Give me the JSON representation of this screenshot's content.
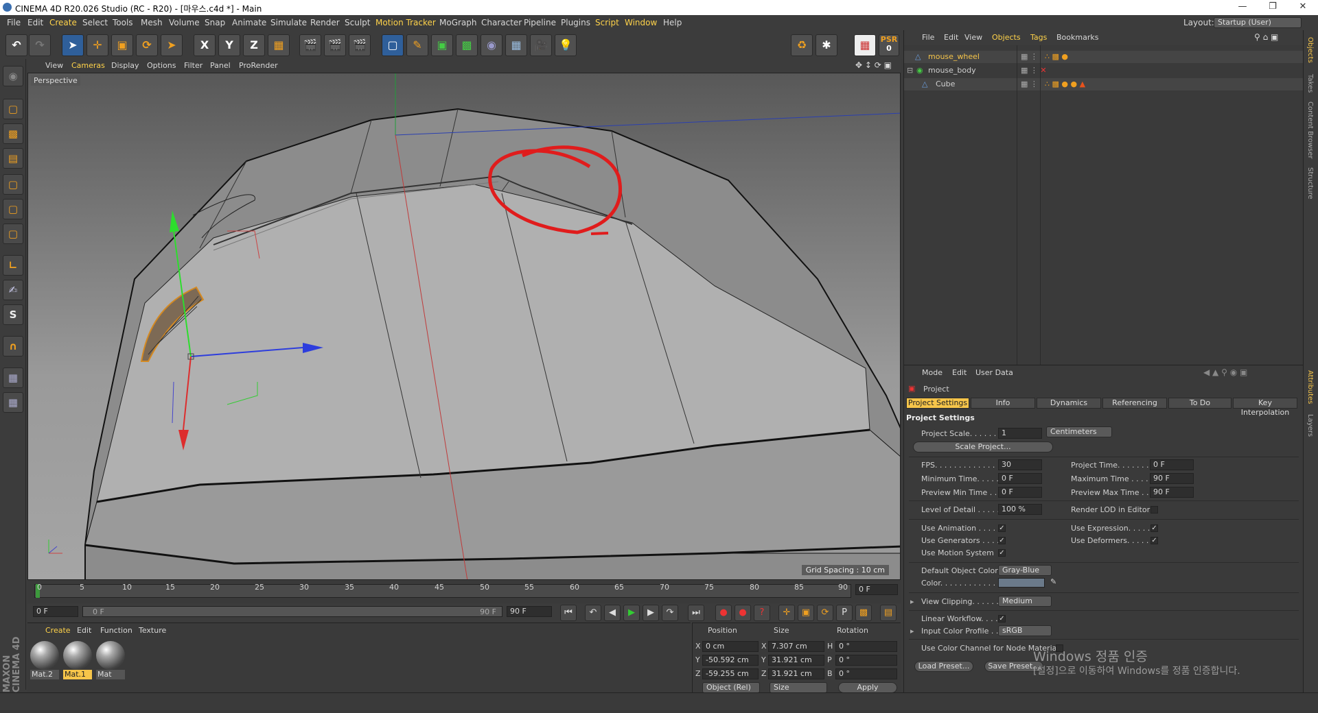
{
  "window": {
    "title": "CINEMA 4D R20.026 Studio (RC - R20) - [마우스.c4d *] - Main"
  },
  "menu": [
    "File",
    "Edit",
    "Create",
    "Select",
    "Tools",
    "Mesh",
    "Volume",
    "Snap",
    "Animate",
    "Simulate",
    "Render",
    "Sculpt",
    "Motion Tracker",
    "MoGraph",
    "Character",
    "Pipeline",
    "Plugins",
    "Script",
    "Window",
    "Help"
  ],
  "layout": {
    "label": "Layout:",
    "value": "Startup (User)"
  },
  "toolbar": {
    "x": "X",
    "y": "Y",
    "z": "Z",
    "psr": "PSR",
    "psr_value": "0"
  },
  "viewport": {
    "menu": [
      "View",
      "Cameras",
      "Display",
      "Options",
      "Filter",
      "Panel",
      "ProRender"
    ],
    "label": "Perspective",
    "grid_spacing": "Grid Spacing : 10 cm"
  },
  "timeline": {
    "ticks": [
      "0",
      "5",
      "10",
      "15",
      "20",
      "25",
      "30",
      "35",
      "40",
      "45",
      "50",
      "55",
      "60",
      "65",
      "70",
      "75",
      "80",
      "85",
      "90"
    ],
    "current_frame": "0 F",
    "start": "0 F",
    "range_start": "0 F",
    "range_end": "90 F",
    "end": "90 F"
  },
  "materials": {
    "menu": [
      "Create",
      "Edit",
      "Function",
      "Texture"
    ],
    "items": [
      "Mat.2",
      "Mat.1",
      "Mat"
    ]
  },
  "coords": {
    "headers": [
      "Position",
      "Size",
      "Rotation"
    ],
    "rows": [
      {
        "axis": "X",
        "pos": "0 cm",
        "saxis": "X",
        "size": "7.307 cm",
        "raxis": "H",
        "rot": "0 °"
      },
      {
        "axis": "Y",
        "pos": "-50.592 cm",
        "saxis": "Y",
        "size": "31.921 cm",
        "raxis": "P",
        "rot": "0 °"
      },
      {
        "axis": "Z",
        "pos": "-59.255 cm",
        "saxis": "Z",
        "size": "31.921 cm",
        "raxis": "B",
        "rot": "0 °"
      }
    ],
    "mode": "Object (Rel)",
    "size_mode": "Size",
    "apply": "Apply"
  },
  "objects": {
    "menu": [
      "File",
      "Edit",
      "View",
      "Objects",
      "Tags",
      "Bookmarks"
    ],
    "items": [
      "mouse_wheel",
      "mouse_body",
      "Cube"
    ]
  },
  "attributes": {
    "menu": [
      "Mode",
      "Edit",
      "User Data"
    ],
    "header": "Project",
    "tabs": [
      "Project Settings",
      "Info",
      "Dynamics",
      "Referencing",
      "To Do",
      "Key Interpolation"
    ],
    "section": "Project Settings",
    "project_scale_label": "Project Scale. . . . . . .",
    "project_scale": "1",
    "project_scale_unit": "Centimeters",
    "scale_project": "Scale Project...",
    "fps_label": "FPS. . . . . . . . . . . . . . .",
    "fps": "30",
    "project_time_label": "Project Time. . . . . . . .",
    "project_time": "0 F",
    "min_time_label": "Minimum Time. . . . . .",
    "min_time": "0 F",
    "max_time_label": "Maximum Time . . . . .",
    "max_time": "90 F",
    "prev_min_label": "Preview Min Time . .",
    "prev_min": "0 F",
    "prev_max_label": "Preview Max Time . .",
    "prev_max": "90 F",
    "lod_label": "Level of Detail . . . . .",
    "lod": "100 %",
    "render_lod_label": "Render LOD in Editor",
    "use_animation": "Use Animation . . . . .",
    "use_expression": "Use Expression. . . . .",
    "use_generators": "Use Generators . . . .",
    "use_deformers": "Use Deformers. . . . . .",
    "use_motion": "Use Motion System",
    "default_color_label": "Default Object Color",
    "default_color": "Gray-Blue",
    "color_label": "Color. . . . . . . . . . . . .",
    "view_clipping_label": "View Clipping. . . . . .",
    "view_clipping": "Medium",
    "linear_workflow": "Linear Workflow. . . .",
    "input_color_label": "Input Color Profile . .",
    "input_color": "sRGB",
    "node_material": "Use Color Channel for Node Material",
    "load_preset": "Load Preset...",
    "save_preset": "Save Preset..."
  },
  "side_tabs": [
    "Objects",
    "Takes",
    "Content Browser",
    "Structure"
  ],
  "side_tabs2": [
    "Attributes",
    "Layers"
  ],
  "watermark": {
    "line1": "Windows 정품 인증",
    "line2": "[설정]으로 이동하여 Windows를 정품 인증합니다."
  },
  "brand": "MAXON CINEMA 4D"
}
